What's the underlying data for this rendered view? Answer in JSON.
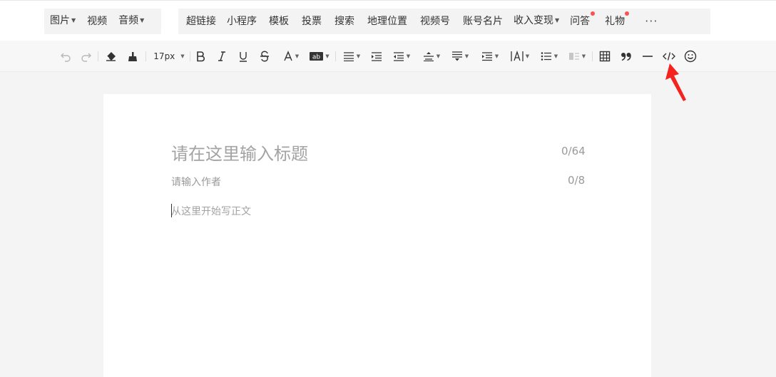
{
  "insert_menu": {
    "group1": [
      {
        "label": "图片",
        "has_dropdown": true
      },
      {
        "label": "视频",
        "has_dropdown": false
      },
      {
        "label": "音频",
        "has_dropdown": true
      }
    ],
    "group2": [
      {
        "label": "超链接",
        "has_dropdown": false,
        "badge": false
      },
      {
        "label": "小程序",
        "has_dropdown": false,
        "badge": false
      },
      {
        "label": "模板",
        "has_dropdown": false,
        "badge": false
      },
      {
        "label": "投票",
        "has_dropdown": false,
        "badge": false
      },
      {
        "label": "搜索",
        "has_dropdown": false,
        "badge": false
      },
      {
        "label": "地理位置",
        "has_dropdown": false,
        "badge": false
      },
      {
        "label": "视频号",
        "has_dropdown": false,
        "badge": false
      },
      {
        "label": "账号名片",
        "has_dropdown": false,
        "badge": false
      },
      {
        "label": "收入变现",
        "has_dropdown": true,
        "badge": false
      },
      {
        "label": "问答",
        "has_dropdown": false,
        "badge": true
      },
      {
        "label": "礼物",
        "has_dropdown": false,
        "badge": true
      }
    ],
    "more_label": "···"
  },
  "toolbar": {
    "font_size": "17px",
    "icons": [
      "undo-icon",
      "redo-icon",
      "eraser-icon",
      "format-painter-icon",
      "bold-icon",
      "italic-icon",
      "underline-icon",
      "strikethrough-icon",
      "font-color-icon",
      "background-color-icon",
      "align-icon",
      "indent-icon",
      "first-line-indent-icon",
      "line-height-icon",
      "paragraph-spacing-icon",
      "margin-icon",
      "letter-spacing-icon",
      "list-icon",
      "border-icon",
      "table-icon",
      "quote-icon",
      "divider-icon",
      "code-icon",
      "emoji-icon"
    ]
  },
  "editor": {
    "title_placeholder": "请在这里输入标题",
    "title_counter": "0/64",
    "author_placeholder": "请输入作者",
    "author_counter": "0/8",
    "body_placeholder": "从这里开始写正文"
  },
  "colors": {
    "accent_red": "#fa5151",
    "annotation_arrow": "#f5231d"
  }
}
